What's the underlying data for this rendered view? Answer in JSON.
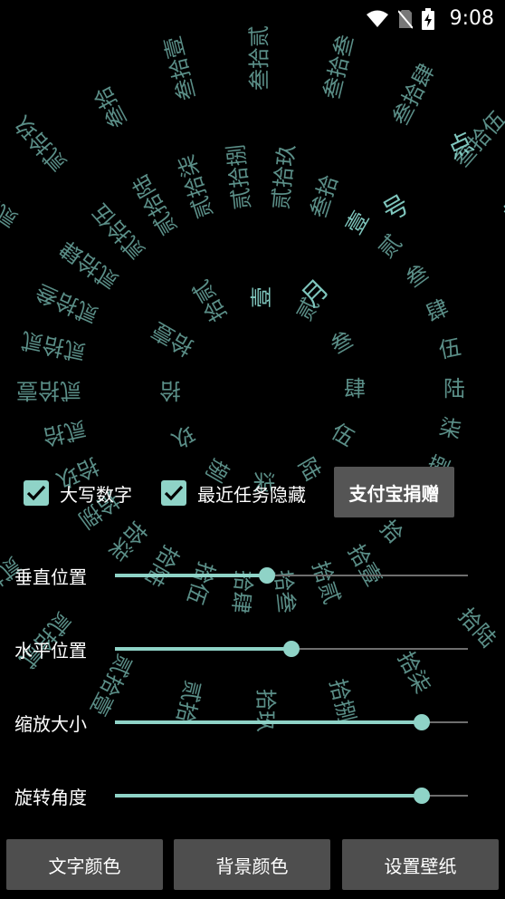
{
  "status_bar": {
    "time": "9:08"
  },
  "background": {
    "text_color": "#7fc6bd",
    "hour_ring": [
      "壹",
      "贰",
      "叁",
      "肆",
      "伍",
      "陆",
      "柒",
      "捌",
      "玖",
      "拾",
      "拾壹",
      "拾贰"
    ],
    "day_ring": [
      "壹",
      "贰",
      "叁",
      "肆",
      "伍",
      "陆",
      "柒",
      "捌",
      "玖",
      "拾",
      "拾壹",
      "拾贰",
      "拾叁",
      "拾肆",
      "拾伍",
      "拾陆",
      "拾柒",
      "拾捌",
      "拾玖",
      "贰拾",
      "贰拾壹",
      "贰拾贰",
      "贰拾叁",
      "贰拾肆",
      "贰拾伍",
      "贰拾陆",
      "贰拾柒",
      "贰拾捌",
      "贰拾玖",
      "叁拾"
    ],
    "minute_ring": [
      "拾",
      "拾壹",
      "拾贰",
      "拾叁",
      "拾肆",
      "拾伍",
      "拾陆",
      "拾柒",
      "拾捌",
      "拾玖",
      "贰拾",
      "贰拾壹",
      "贰拾贰",
      "贰拾叁",
      "贰拾肆",
      "贰拾伍",
      "贰拾陆",
      "贰拾柒",
      "贰拾捌",
      "贰拾玖",
      "叁拾",
      "叁拾壹",
      "叁拾贰",
      "叁拾叁",
      "叁拾肆",
      "叁拾伍"
    ],
    "marks": {
      "month": "月",
      "day": "号",
      "hour": "点"
    }
  },
  "options": {
    "uppercase_label": "大写数字",
    "hide_recents_label": "最近任务隐藏",
    "alipay_button": "支付宝捐赠"
  },
  "sliders": [
    {
      "label": "垂直位置",
      "value": 0.43
    },
    {
      "label": "水平位置",
      "value": 0.5
    },
    {
      "label": "缩放大小",
      "value": 0.87
    },
    {
      "label": "旋转角度",
      "value": 0.87
    }
  ],
  "buttons": {
    "text_color": "文字颜色",
    "background_color": "背景颜色",
    "set_wallpaper": "设置壁纸"
  },
  "colors": {
    "accent": "#8fd3c7"
  }
}
